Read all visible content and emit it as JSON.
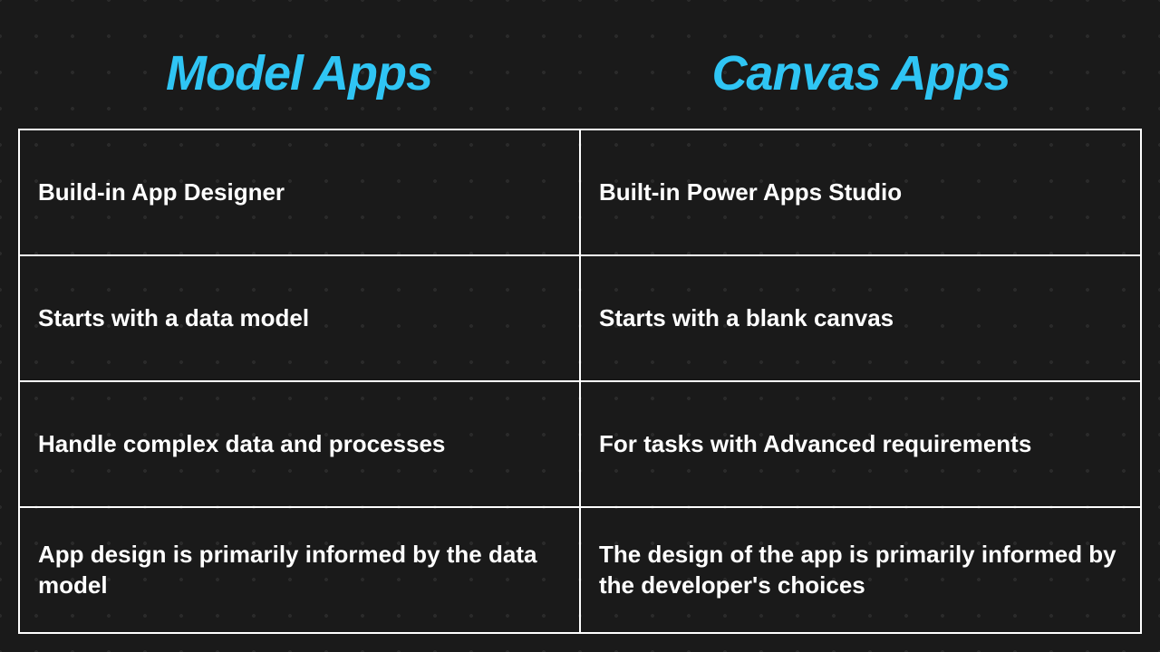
{
  "headers": {
    "left": "Model Apps",
    "right": "Canvas Apps"
  },
  "rows": [
    {
      "left": "Build-in App Designer",
      "right": "Built-in Power Apps Studio"
    },
    {
      "left": "Starts with a data model",
      "right": "Starts with a blank canvas"
    },
    {
      "left": "Handle complex data and processes",
      "right": "For tasks with Advanced requirements"
    },
    {
      "left": "App design is primarily informed by the data model",
      "right": "The design of the app is primarily informed by the developer's choices"
    }
  ],
  "chart_data": {
    "type": "table",
    "title": "Model Apps vs Canvas Apps",
    "columns": [
      "Model Apps",
      "Canvas Apps"
    ],
    "rows": [
      [
        "Build-in App Designer",
        "Built-in Power Apps Studio"
      ],
      [
        "Starts with a data model",
        "Starts with a blank canvas"
      ],
      [
        "Handle complex data and processes",
        "For tasks with Advanced requirements"
      ],
      [
        "App design is primarily informed by the data model",
        "The design of the app is primarily informed by the developer's choices"
      ]
    ]
  }
}
